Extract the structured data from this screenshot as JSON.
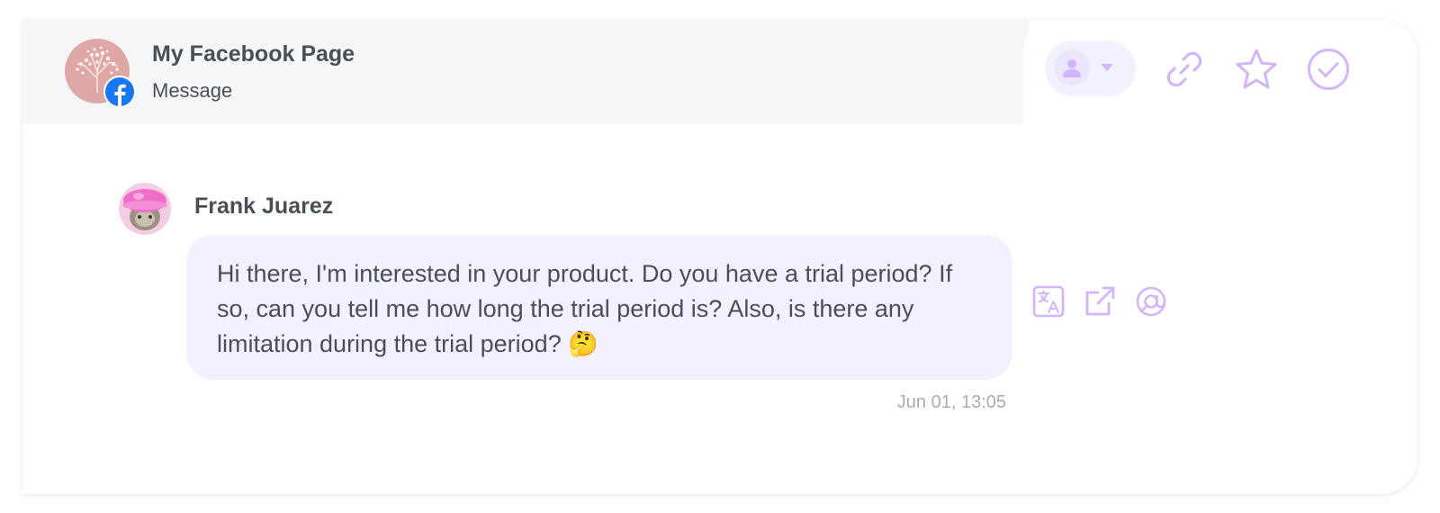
{
  "header": {
    "page_name": "My Facebook Page",
    "channel_type": "Message"
  },
  "toolbar": {
    "icons": [
      "user-icon",
      "chevron-down-icon",
      "link-icon",
      "star-icon",
      "check-circle-icon"
    ]
  },
  "message": {
    "sender": "Frank Juarez",
    "text": "Hi there, I'm interested in your product. Do you have a trial period? If so, can you tell me how long the trial period is? Also, is there any limitation during the trial period? 🤔",
    "timestamp": "Jun 01, 13:05",
    "actions": [
      "translate-icon",
      "external-link-icon",
      "at-mention-icon"
    ]
  },
  "colors": {
    "accent": "#d3b5fb",
    "bubble": "#f4f1fe",
    "header_bg": "#f5f6f8",
    "text": "#4a4f56",
    "muted": "#a9adb3",
    "facebook": "#1877f2"
  }
}
